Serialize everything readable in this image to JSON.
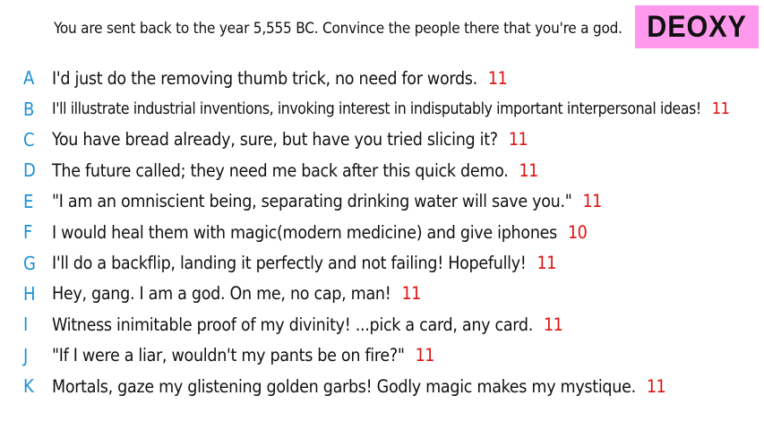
{
  "prompt": "You are sent back to the year 5,555 BC. Convince the people there that you're a god.",
  "player_name": "DEOXY",
  "colors": {
    "letter": "#1a8fd6",
    "score": "#e01010",
    "badge_bg": "#ff99ee",
    "text": "#111111"
  },
  "answers": [
    {
      "letter": "A",
      "text": "I'd just do the removing thumb trick, no need for words.",
      "score": "11"
    },
    {
      "letter": "B",
      "text": "I'll illustrate industrial inventions, invoking interest in indisputably important interpersonal ideas!",
      "score": "11"
    },
    {
      "letter": "C",
      "text": "You have bread already, sure, but have you tried slicing it?",
      "score": "11"
    },
    {
      "letter": "D",
      "text": "The future called; they need me back after this quick demo.",
      "score": "11"
    },
    {
      "letter": "E",
      "text": "\"I am an omniscient being, separating drinking water will save you.\"",
      "score": "11"
    },
    {
      "letter": "F",
      "text": "I would heal them with magic(modern medicine) and give iphones",
      "score": "10"
    },
    {
      "letter": "G",
      "text": "I'll do a backflip, landing it perfectly and not failing! Hopefully!",
      "score": "11"
    },
    {
      "letter": "H",
      "text": "Hey, gang. I am a god. On me, no cap, man!",
      "score": "11"
    },
    {
      "letter": "I",
      "text": "Witness inimitable proof of my divinity! ...pick a card, any card.",
      "score": "11"
    },
    {
      "letter": "J",
      "text": "\"If I were a liar, wouldn't my pants be on fire?\"",
      "score": "11"
    },
    {
      "letter": "K",
      "text": "Mortals, gaze my glistening golden garbs! Godly magic makes my mystique.",
      "score": "11"
    }
  ]
}
